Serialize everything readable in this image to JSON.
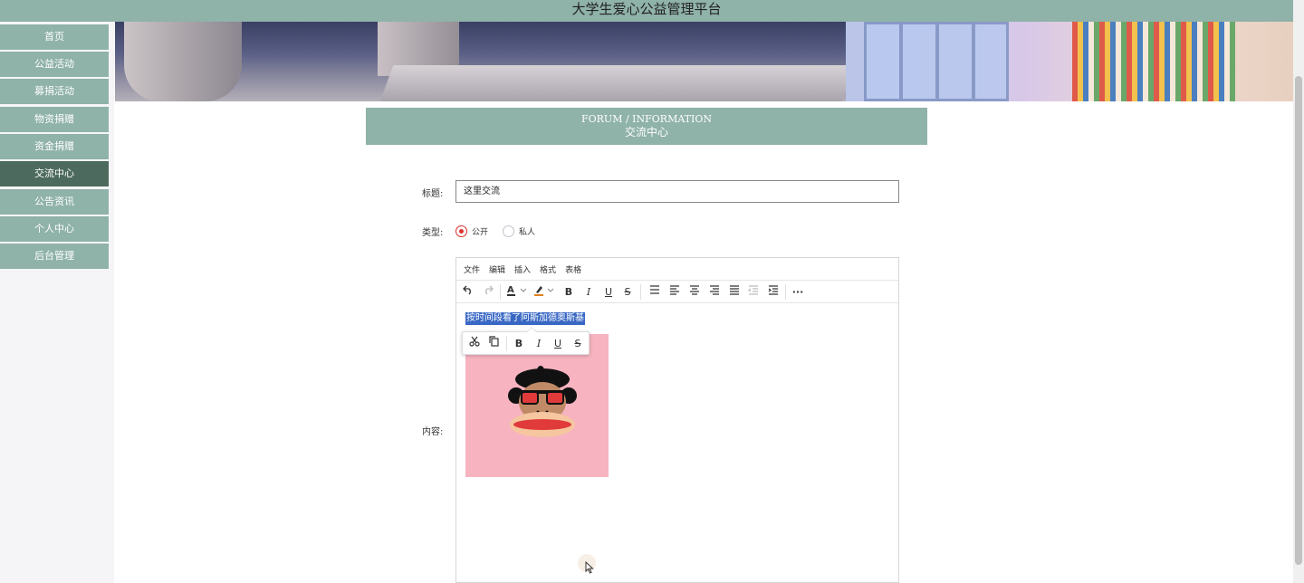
{
  "header": {
    "title": "大学生爱心公益管理平台"
  },
  "sidebar": {
    "items": [
      {
        "label": "首页"
      },
      {
        "label": "公益活动"
      },
      {
        "label": "募捐活动"
      },
      {
        "label": "物资捐赠"
      },
      {
        "label": "资金捐赠"
      },
      {
        "label": "交流中心",
        "active": true
      },
      {
        "label": "公告资讯"
      },
      {
        "label": "个人中心"
      },
      {
        "label": "后台管理"
      }
    ]
  },
  "section": {
    "title_en": "FORUM / INFORMATION",
    "title_cn": "交流中心"
  },
  "form": {
    "title_label": "标题:",
    "title_value": "这里交流",
    "type_label": "类型:",
    "type_options": [
      {
        "label": "公开",
        "checked": true
      },
      {
        "label": "私人",
        "checked": false
      }
    ],
    "content_label": "内容:"
  },
  "editor": {
    "menu": [
      "文件",
      "编辑",
      "插入",
      "格式",
      "表格"
    ],
    "toolbar_icons": [
      "undo-icon",
      "redo-icon",
      "font-color-icon",
      "highlight-color-icon",
      "bold-icon",
      "italic-icon",
      "underline-icon",
      "strikethrough-icon",
      "line-height-icon",
      "align-left-icon",
      "align-center-icon",
      "align-right-icon",
      "align-justify-icon",
      "outdent-icon",
      "indent-icon",
      "more-icon"
    ],
    "selected_text": "按时间段看了阿斯加德奥斯基",
    "popup_icons": [
      "cut-icon",
      "copy-icon",
      "bold-icon",
      "italic-icon",
      "underline-icon",
      "strikethrough-icon"
    ],
    "image": {
      "alt": "monkey-avatar",
      "background": "#f7b3c0"
    }
  },
  "colors": {
    "accent": "#8fb2a9",
    "accent_dark": "#4c6b5e",
    "selection": "#3968c4",
    "radio_checked": "#dd3333"
  }
}
